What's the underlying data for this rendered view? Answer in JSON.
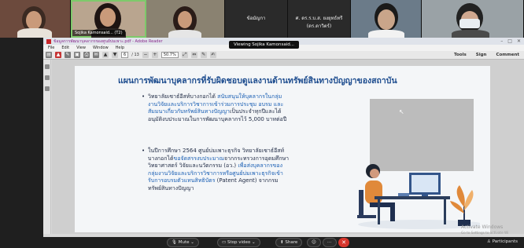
{
  "video_tiles": [
    {
      "name": ""
    },
    {
      "name": "",
      "caption": "Sojika Kamonsaid... (T2)"
    },
    {
      "name": ""
    },
    {
      "name": "ข้อมัญกา"
    },
    {
      "name": "ศ. ดร.ร.บ.ส. ยงยุทธ์ทรี (ดร.ดาวิตร์)"
    },
    {
      "name": ""
    },
    {
      "name": ""
    }
  ],
  "window": {
    "title": "ข้อมูลการพัฒนาบุคลากรของศูนย์บ่มเพาะ.pdf - Adobe Reader",
    "menu": [
      "File",
      "Edit",
      "View",
      "Window",
      "Help"
    ],
    "page_current": "6",
    "page_total": "/ 13",
    "zoom": "50.7%",
    "tools": [
      "Tools",
      "Sign",
      "Comment"
    ],
    "tooltip": "Viewing Sojika Kamonsaid..."
  },
  "slide": {
    "title": "แผนการพัฒนาบุคลากรที่รับผิดชอบดูแลงานด้านทรัพย์สินทางปัญญาของสถาบัน",
    "bullet1": {
      "lines": [
        [
          "วิทยาลัยเซาธ์อีสท์บางกอกได้ ",
          "สนับสนุนให้บุคลากรในกลุ่ม"
        ],
        [
          "",
          "งานวิจัยและบริการวิชาการเข้าร่วมการประชุม อบรม และ"
        ],
        [
          "",
          "สัมมนาเกี่ยวกับทรัพย์สินทางปัญญา"
        ],
        [
          "อนุมัติงบประมาณในการพัฒนาบุคลากรไว้ 5,000 บาทต่อปี",
          ""
        ]
      ],
      "tail": "เป็นประจำทุกปีและได้"
    },
    "bullet2": {
      "line1": "ในปีการศึกษา 2564 ศูนย์บ่มเพาะธุรกิจ วิทยาลัยเซาธ์อีสท์",
      "line2a": "บางกอกได้",
      "line2b": "ขอจัดสรรงบประมาณ",
      "line2c": "จากกระทรวงการอุดมศึกษา",
      "line3a": "วิทยาศาสตร์ วิจัยและนวัตกรรม (อว.) ",
      "line3b": "เพื่อส่งบุคลากรของ",
      "line4": "กลุ่มงานวิจัยและบริการวิชาการหรือศูนย์บ่มเพาะธุรกิจเข้า",
      "line5a": "รับการอบรมตัวแทนสิทธิบัตร",
      "line5b": " (Patent Agent) จากกรม",
      "line6": "ทรัพย์สินทางปัญญา"
    }
  },
  "meeting": {
    "mute": "Mute",
    "stop_video": "Stop video",
    "share": "Share",
    "participants": "Participants"
  },
  "watermark": {
    "line1": "Activate Windows",
    "line2": "Go to Settings to activate Wi"
  },
  "colors": {
    "title_blue": "#1e4d8f",
    "highlight_blue": "#1a5fb4",
    "leave_red": "#d7352c"
  }
}
